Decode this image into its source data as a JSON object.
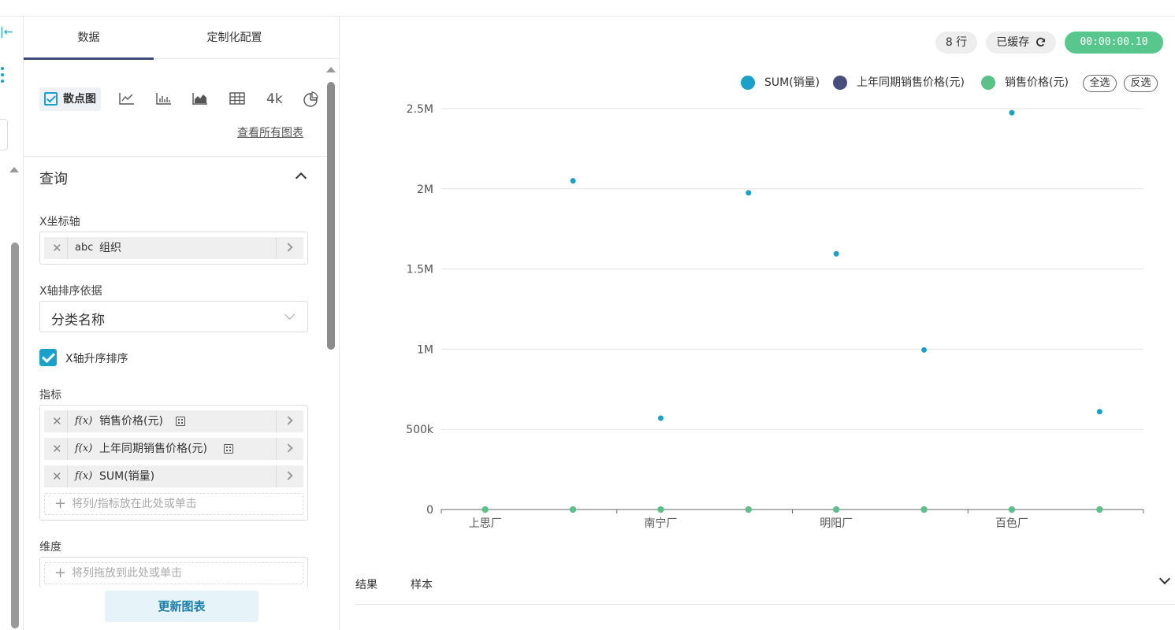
{
  "panel": {
    "tabs": [
      "数据",
      "定制化配置"
    ],
    "chart_types": {
      "selected_label": "散点图",
      "icons": [
        "line-chart-icon",
        "bar-chart-icon",
        "area-chart-icon",
        "table-icon",
        "big-number-icon",
        "pie-chart-icon"
      ],
      "big_number_label": "4k"
    },
    "view_all_link": "查看所有图表",
    "query": {
      "title": "查询",
      "x_axis_label": "X坐标轴",
      "x_axis_field": {
        "type": "abc",
        "name": "组织"
      },
      "x_sort_label": "X轴排序依据",
      "x_sort_value": "分类名称",
      "ascending_label": "X轴升序排序",
      "ascending_checked": true,
      "metrics_label": "指标",
      "metrics": [
        {
          "type": "f(x)",
          "name": "销售价格(元)"
        },
        {
          "type": "f(x)",
          "name": "上年同期销售价格(元)"
        },
        {
          "type": "f(x)",
          "name": "SUM(销量)"
        }
      ],
      "metrics_placeholder": "将列/指标放在此处或单击",
      "dimensions_label": "维度",
      "dimensions_placeholder": "将列拖放到此处或单击"
    },
    "update_button": "更新图表"
  },
  "status": {
    "rows": "8 行",
    "cached": "已缓存",
    "time": "00:00:00.10"
  },
  "legend": {
    "items": [
      {
        "name": "SUM(销量)",
        "color": "#1aa1c9"
      },
      {
        "name": "上年同期销售价格(元)",
        "color": "#454e7c"
      },
      {
        "name": "销售价格(元)",
        "color": "#5ac189"
      }
    ],
    "select_all": "全选",
    "invert": "反选"
  },
  "results_tabs": [
    "结果",
    "样本"
  ],
  "chart_data": {
    "type": "scatter",
    "categories": [
      "上思厂",
      "",
      "南宁厂",
      "",
      "明阳厂",
      "",
      "百色厂",
      ""
    ],
    "x_tick_labels": [
      "上思厂",
      "南宁厂",
      "明阳厂",
      "百色厂"
    ],
    "y_ticks": [
      "0",
      "500k",
      "1M",
      "1.5M",
      "2M",
      "2.5M"
    ],
    "ylim": [
      0,
      2500000
    ],
    "grid": true,
    "legend_position": "top-right",
    "series": [
      {
        "name": "SUM(销量)",
        "color": "#1aa1c9",
        "values": [
          0,
          2050000,
          570000,
          1975000,
          1595000,
          995000,
          2475000,
          610000
        ]
      },
      {
        "name": "上年同期销售价格(元)",
        "color": "#454e7c",
        "values": [
          0,
          0,
          0,
          0,
          0,
          0,
          0,
          0
        ]
      },
      {
        "name": "销售价格(元)",
        "color": "#5ac189",
        "values": [
          0,
          0,
          0,
          0,
          0,
          0,
          0,
          0
        ]
      }
    ]
  }
}
